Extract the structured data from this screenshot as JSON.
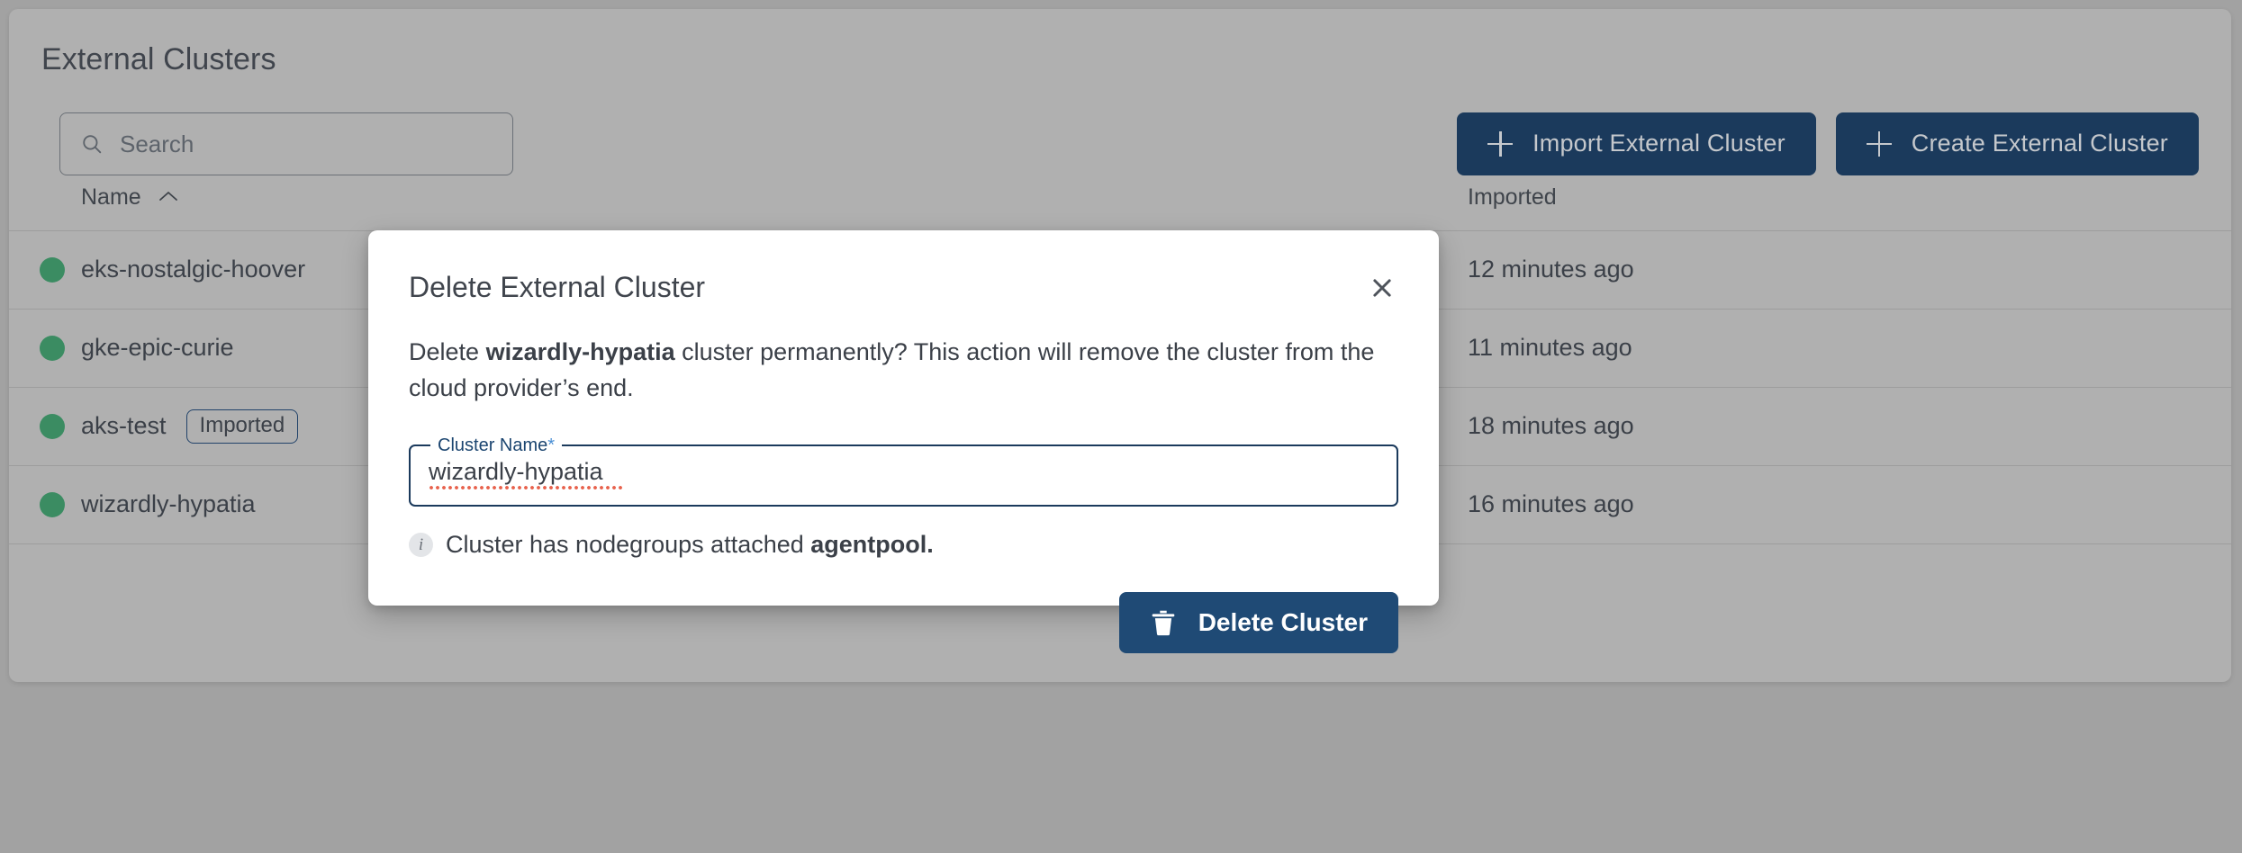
{
  "page": {
    "title": "External Clusters",
    "background_color": "#a2a2a2",
    "card_color": "#b0b0b0"
  },
  "search": {
    "placeholder": "Search",
    "value": "",
    "icon": "search-icon"
  },
  "toolbar": {
    "import_label": "Import External Cluster",
    "create_label": "Create External Cluster",
    "button_color": "#1b3a5c"
  },
  "table": {
    "columns": [
      {
        "key": "status",
        "label": ""
      },
      {
        "key": "name",
        "label": "Name",
        "sorted": "asc",
        "sort_icon": "chevron-up-icon"
      },
      {
        "key": "mid",
        "label": ""
      },
      {
        "key": "imported",
        "label": "Imported"
      }
    ],
    "rows": [
      {
        "status": "healthy",
        "name": "eks-nostalgic-hoover",
        "chip": "",
        "imported": "12 minutes ago"
      },
      {
        "status": "healthy",
        "name": "gke-epic-curie",
        "chip": "",
        "imported": "11 minutes ago"
      },
      {
        "status": "healthy",
        "name": "aks-test",
        "chip": "Imported",
        "imported": "18 minutes ago"
      },
      {
        "status": "healthy",
        "name": "wizardly-hypatia",
        "chip": "",
        "imported": "16 minutes ago"
      }
    ],
    "status_color": "#3b8c62"
  },
  "modal": {
    "title": "Delete External Cluster",
    "close_icon": "close-icon",
    "body_prefix": "Delete ",
    "body_cluster": "wizardly-hypatia",
    "body_suffix": " cluster permanently? This action will remove the cluster from the cloud provider’s end.",
    "field": {
      "label": "Cluster Name",
      "required_marker": "*",
      "value": "wizardly-hypatia",
      "placeholder": "",
      "border_color": "#1b3a5c",
      "label_color": "#1b4570"
    },
    "info": {
      "icon": "info-icon",
      "glyph": "i",
      "text_prefix": "Cluster has nodegroups attached ",
      "text_bold": "agentpool."
    },
    "delete_button": {
      "label": "Delete Cluster",
      "icon": "trash-icon",
      "color": "#1f4a75"
    }
  }
}
